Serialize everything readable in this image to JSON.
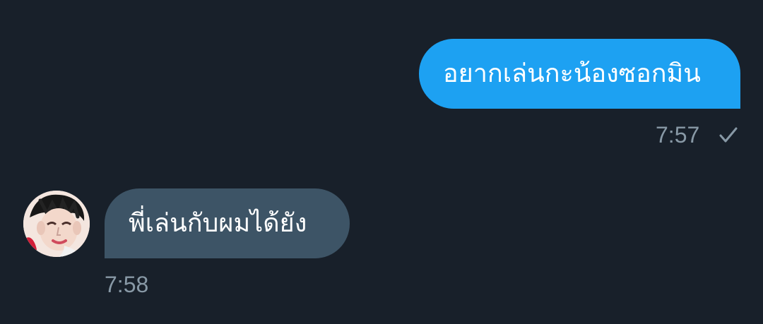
{
  "messages": [
    {
      "direction": "outgoing",
      "text": "อยากเล่นกะน้องซอกมิน",
      "time": "7:57",
      "status_icon": "check-icon",
      "bubble_color": "#1da1f2"
    },
    {
      "direction": "incoming",
      "text": "พี่เล่นกับผมได้ยัง",
      "time": "7:58",
      "avatar": "avatar",
      "bubble_color": "#3d5466"
    }
  ],
  "colors": {
    "background": "#18202a",
    "timestamp": "#8899a6",
    "message_text": "#ffffff"
  }
}
